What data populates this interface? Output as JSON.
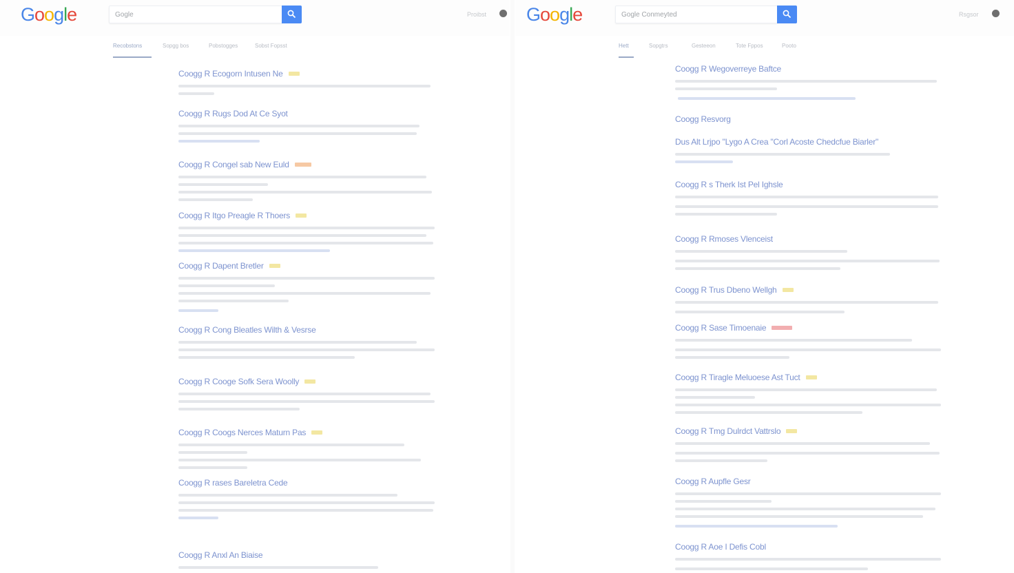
{
  "colors": {
    "logo_blue": "#4a86e8",
    "logo_red": "#e5483a",
    "logo_yellow": "#f4b400",
    "logo_green": "#37a853",
    "result_title": "#7d93cf",
    "search_button": "#4a8af4",
    "badge_yellow": "#f3e7a2",
    "badge_red": "#f2aeb0"
  },
  "left": {
    "logo": [
      "G",
      "o",
      "o",
      "g",
      "l",
      "e"
    ],
    "search": {
      "value": "Gogle"
    },
    "user": {
      "label": "Proibst"
    },
    "tabs": [
      "Recobstons",
      "Sopgg bos",
      "Pobstogges",
      "Sobst Fopsst"
    ],
    "results": [
      {
        "title": "Coogg R Ecogorn Intusen Ne",
        "badge": "yellow"
      },
      {
        "title": "Coogg R Rugs Dod At Ce Syot"
      },
      {
        "title": "Coogg R Congel sab New Euld",
        "badge": "orange"
      },
      {
        "title": "Coogg R Itgo Preagle R Thoers",
        "badge": "yellow"
      },
      {
        "title": "Coogg R Dapent Bretler",
        "badge": "yellow"
      },
      {
        "title": "Coogg R Cong Bleatles Wilth & Vesrse"
      },
      {
        "title": "Coogg R Cooge Sofk Sera Woolly",
        "badge": "yellow"
      },
      {
        "title": "Coogg R Coogs Nerces Maturn Pas",
        "badge": "yellow"
      },
      {
        "title": "Coogg R rases Bareletra Cede"
      },
      {
        "title": "Coogg R Anxl An Biaise"
      }
    ]
  },
  "right": {
    "logo": [
      "G",
      "o",
      "o",
      "g",
      "l",
      "e"
    ],
    "search": {
      "value": "Gogle Conmeyted"
    },
    "user": {
      "label": "Rsgsor"
    },
    "tabs": [
      "Hett",
      "Sopgtrs",
      "Gesteeon",
      "Tote Fppos",
      "Pooto"
    ],
    "results": [
      {
        "title": "Coogg R Wegoverreye Baftce"
      },
      {
        "title": "Coogg Resvorg"
      },
      {
        "title": "Dus Alt Lrjpo \"Lygo A Crea \"Corl Acoste Chedcfue Biarler\""
      },
      {
        "title": "Coogg R s Therk Ist Pel Ighsle"
      },
      {
        "title": "Coogg R Rmoses Vlenceist"
      },
      {
        "title": "Coogg R Trus Dbeno Wellgh",
        "badge": "yellow"
      },
      {
        "title": "Coogg R Sase Timoenaie",
        "badge": "red"
      },
      {
        "title": "Coogg R Tiragle Meluoese Ast Tuct",
        "badge": "yellow"
      },
      {
        "title": "Coogg R Tmg Dulrdct Vattrslo",
        "badge": "yellow"
      },
      {
        "title": "Coogg R Aupfle Gesr"
      },
      {
        "title": "Coogg R Aoe I Defis Cobl"
      }
    ]
  }
}
